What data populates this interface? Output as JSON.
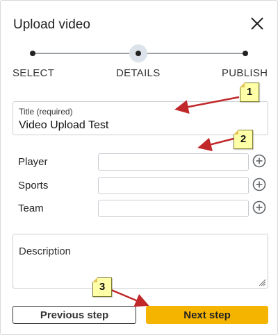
{
  "dialog": {
    "title": "Upload video",
    "close_icon": "close-icon"
  },
  "stepper": {
    "steps": [
      {
        "label": "SELECT"
      },
      {
        "label": "DETAILS"
      },
      {
        "label": "PUBLISH"
      }
    ],
    "active_index": 1
  },
  "form": {
    "title_label": "Title (required)",
    "title_value": "Video Upload Test",
    "rows": [
      {
        "label": "Player",
        "value": ""
      },
      {
        "label": "Sports",
        "value": ""
      },
      {
        "label": "Team",
        "value": ""
      }
    ],
    "description_placeholder": "Description"
  },
  "buttons": {
    "previous": "Previous step",
    "next": "Next step"
  },
  "annotations": [
    "1",
    "2",
    "3"
  ],
  "colors": {
    "accent": "#f5b400",
    "callout_fill": "#ffffa8",
    "arrow": "#c0282a"
  }
}
